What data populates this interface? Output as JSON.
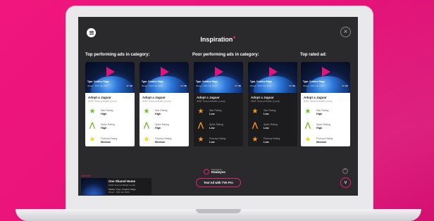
{
  "page": {
    "title": "Inspiration",
    "close_icon": "×",
    "menu_icon": "hamburger-menu-icon"
  },
  "sections": [
    {
      "label": "Top performing ads in category:"
    },
    {
      "label": "Poor performing ads in category:"
    },
    {
      "label": "Top rated ad:"
    }
  ],
  "cards": [
    {
      "theme": "light",
      "thumb_type": "Type, Creative Stage",
      "thumb_date": "30sec · 29th Jun 2020",
      "thumb_score": "27",
      "thumb_market": "UK",
      "name": "Adopt a Jaguar",
      "sub": "WWF Second Middle (Local)",
      "metrics": [
        {
          "label": "Star Rating",
          "value": "High",
          "icon": "star-icon",
          "color": "green"
        },
        {
          "label": "Spike Rating",
          "value": "High",
          "icon": "spike-icon",
          "color": "green"
        },
        {
          "label": "Fluency Rating",
          "value": "Medium",
          "icon": "star-icon",
          "color": "yellow"
        }
      ]
    },
    {
      "theme": "light",
      "thumb_type": "Type, Creative Stage",
      "thumb_date": "30sec · 29th Jun 2020",
      "thumb_score": "27",
      "thumb_market": "UK",
      "name": "Adopt a Jaguar",
      "sub": "WWF Second Middle (Local)",
      "metrics": [
        {
          "label": "Star Rating",
          "value": "High",
          "icon": "star-icon",
          "color": "green"
        },
        {
          "label": "Spike Rating",
          "value": "High",
          "icon": "spike-icon",
          "color": "green"
        },
        {
          "label": "Fluency Rating",
          "value": "Medium",
          "icon": "star-icon",
          "color": "yellow"
        }
      ]
    },
    {
      "theme": "dark",
      "thumb_type": "Type, Creative Stage",
      "thumb_date": "30sec · 29th Jun 2020",
      "thumb_score": "27",
      "thumb_market": "UK",
      "name": "Adopt a Jaguar",
      "sub": "WWF Second Middle (Local)",
      "metrics": [
        {
          "label": "Star Rating",
          "value": "Low",
          "icon": "star-icon",
          "color": "orange"
        },
        {
          "label": "Spike Rating",
          "value": "Low",
          "icon": "spike-icon",
          "color": "orange"
        },
        {
          "label": "Fluency Rating",
          "value": "Low",
          "icon": "star-icon",
          "color": "orange"
        }
      ]
    },
    {
      "theme": "dark",
      "thumb_type": "Type, Creative Stage",
      "thumb_date": "30sec · 29th Jun 2020",
      "thumb_score": "27",
      "thumb_market": "UK",
      "name": "Adopt a Jaguar",
      "sub": "WWF Second Middle (Local)",
      "metrics": [
        {
          "label": "Star Rating",
          "value": "Low",
          "icon": "star-icon",
          "color": "orange"
        },
        {
          "label": "Spike Rating",
          "value": "Low",
          "icon": "spike-icon",
          "color": "orange"
        },
        {
          "label": "Fluency Rating",
          "value": "Low",
          "icon": "star-icon",
          "color": "orange"
        }
      ]
    },
    {
      "theme": "light",
      "thumb_type": "Type, Creative Stage",
      "thumb_date": "30sec · 29th Jun 2020",
      "thumb_score": "27",
      "thumb_market": "UK",
      "name": "Adopt a Jaguar",
      "sub": "WWF Second Middle (Local)",
      "metrics": [
        {
          "label": "Star Rating",
          "value": "High",
          "icon": "star-icon",
          "color": "green"
        },
        {
          "label": "Spike Rating",
          "value": "High",
          "icon": "spike-icon",
          "color": "green"
        },
        {
          "label": "Fluency Rating",
          "value": "Medium",
          "icon": "star-icon",
          "color": "yellow"
        }
      ]
    }
  ],
  "footer": {
    "powered_small": "Powered by",
    "powered_brand": "Realeyes",
    "test_button": "Test Ad with TVA Pro",
    "mini_label": "Selected",
    "mini_title": "One Shared Home",
    "mini_sub": "WWF Second Middle (Local)",
    "mini_meta": "Market, Type, Creative Stage",
    "mini_date": "30sec · 29th Jun 2020",
    "scroll_up": "^",
    "scroll_down": "v"
  },
  "colors": {
    "accent": "#e91e77",
    "background": "#f0167d",
    "screen": "#2a2a2c",
    "green": "#6cc024",
    "orange": "#f29a1f",
    "yellow": "#e9d81b"
  }
}
